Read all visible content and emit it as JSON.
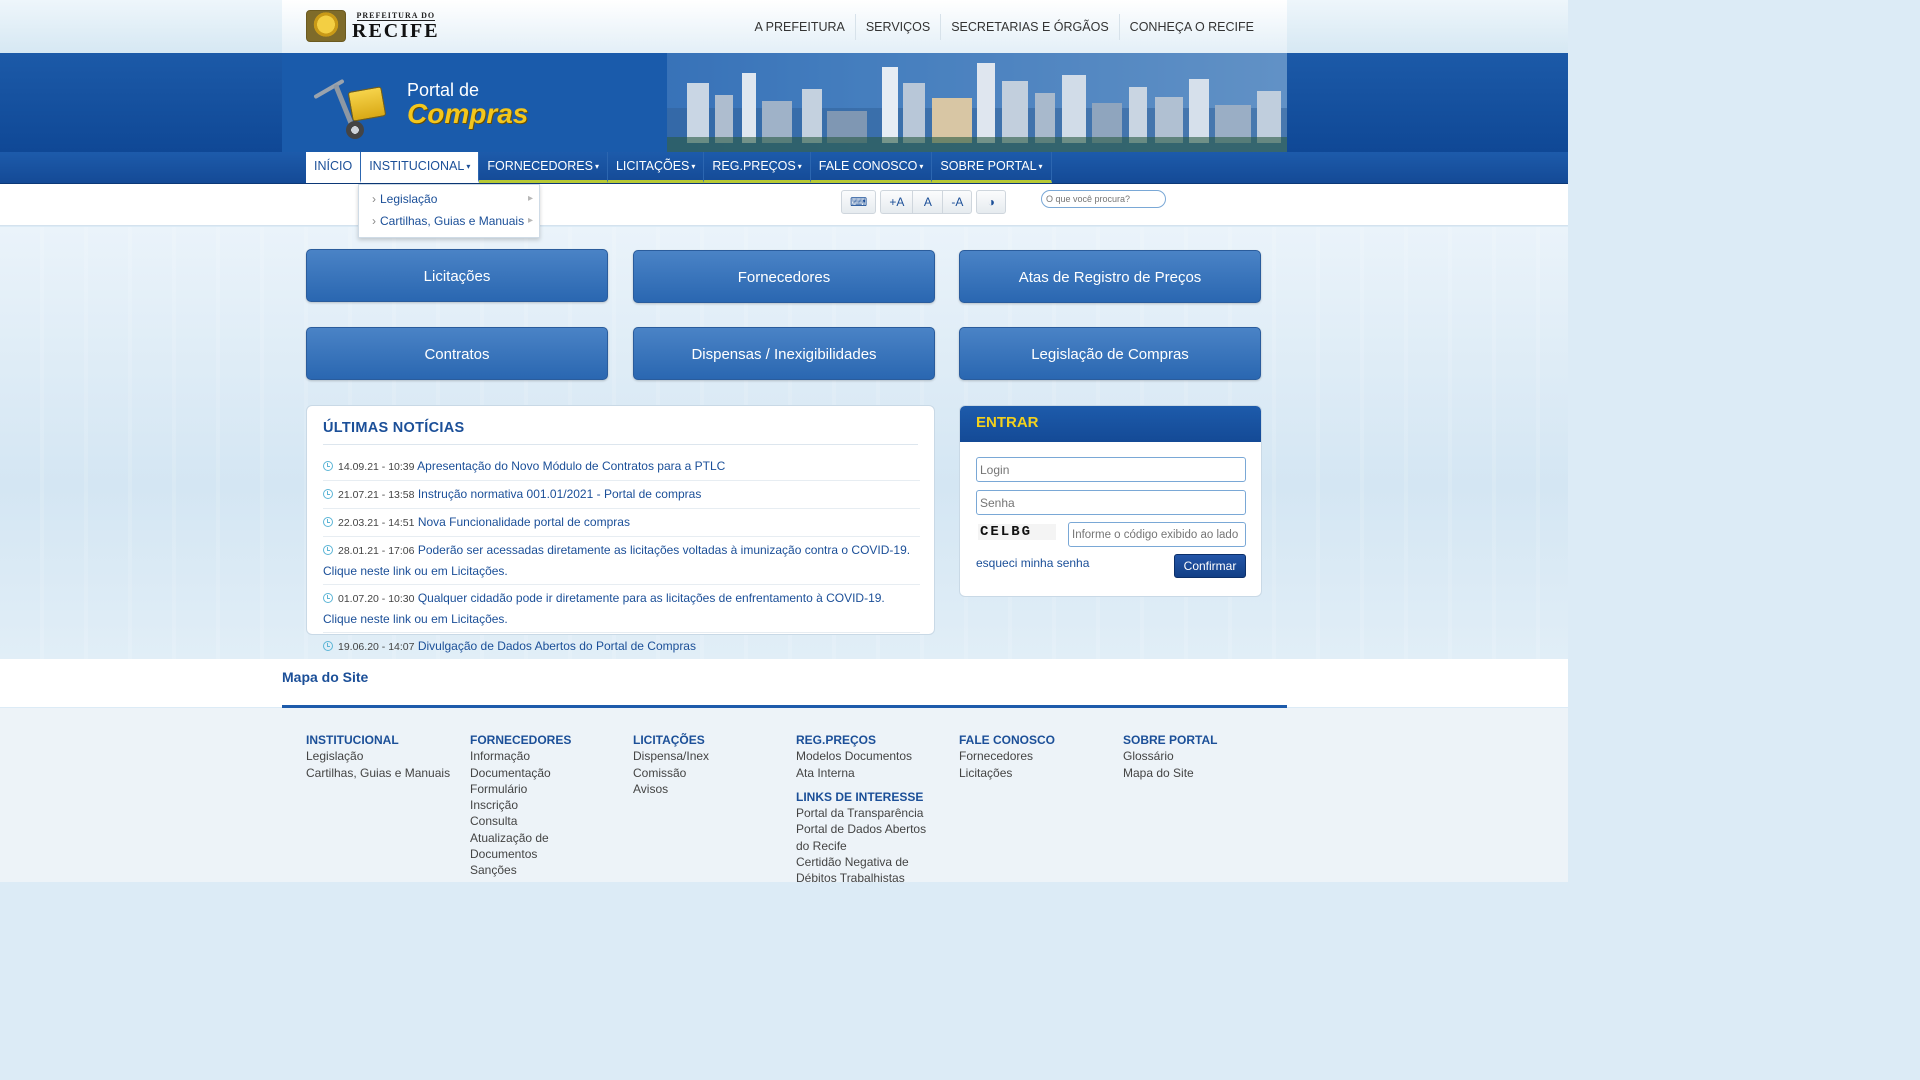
{
  "brand": {
    "top": "PREFEITURA DO",
    "main": "RECIFE"
  },
  "top_nav": [
    "A PREFEITURA",
    "SERVIÇOS",
    "SECRETARIAS E ÓRGÃOS",
    "CONHEÇA O RECIFE"
  ],
  "banner": {
    "line1": "Portal de",
    "line2": "Compras"
  },
  "menu": [
    {
      "label": "INÍCIO",
      "caret": ""
    },
    {
      "label": "INSTITUCIONAL",
      "caret": "▾"
    },
    {
      "label": "FORNECEDORES",
      "caret": "▾"
    },
    {
      "label": "LICITAÇÕES",
      "caret": "▾"
    },
    {
      "label": "REG.PREÇOS",
      "caret": "▾"
    },
    {
      "label": "FALE CONOSCO",
      "caret": "▾"
    },
    {
      "label": "SOBRE PORTAL",
      "caret": "▾"
    }
  ],
  "dropdown": [
    "Legislação",
    "Cartilhas, Guias e Manuais"
  ],
  "a11y": {
    "keyboard": "⌨",
    "increase": "+A",
    "normal": "A",
    "decrease": "-A",
    "contrast": "◑"
  },
  "search": {
    "placeholder": "O que você procura?"
  },
  "quick_links": [
    "Licitações",
    "Fornecedores",
    "Atas de Registro de Preços",
    "Contratos",
    "Dispensas / Inexigibilidades",
    "Legislação de Compras"
  ],
  "news": {
    "title": "ÚLTIMAS NOTÍCIAS",
    "items": [
      {
        "date": "14.09.21 - 10:39",
        "text": "Apresentação do Novo Módulo de Contratos para a PTLC"
      },
      {
        "date": "21.07.21 - 13:58",
        "text": "Instrução normativa 001.01/2021 - Portal de compras"
      },
      {
        "date": "22.03.21 - 14:51",
        "text": "Nova Funcionalidade portal de compras"
      },
      {
        "date": "28.01.21 - 17:06",
        "text": "Poderão ser acessadas diretamente as licitações voltadas à imunização contra o COVID-19. Clique neste link ou em Licitações."
      },
      {
        "date": "01.07.20 - 10:30",
        "text": "Qualquer cidadão pode ir diretamente para as licitações de enfrentamento à COVID-19. Clique neste link ou em Licitações."
      },
      {
        "date": "19.06.20 - 14:07",
        "text": "Divulgação de Dados Abertos do Portal de Compras"
      }
    ]
  },
  "login": {
    "title": "ENTRAR",
    "login_placeholder": "Login",
    "password_placeholder": "Senha",
    "captcha": "CELBG",
    "captcha_placeholder": "Informe o código exibido ao lado",
    "forgot": "esqueci minha senha",
    "confirm": "Confirmar"
  },
  "site_map": {
    "title": "Mapa do Site",
    "columns": [
      {
        "head": "INSTITUCIONAL",
        "links": [
          "Legislação",
          "Cartilhas, Guias e Manuais"
        ]
      },
      {
        "head": "FORNECEDORES",
        "links": [
          "Informação",
          "Documentação",
          "Formulário",
          "Inscrição",
          "Consulta",
          "Atualização de",
          "Documentos",
          "Sanções"
        ]
      },
      {
        "head": "LICITAÇÕES",
        "links": [
          "Dispensa/Inex",
          "Comissão",
          "Avisos"
        ]
      },
      {
        "head": "REG.PREÇOS",
        "links": [
          "Modelos Documentos",
          "Ata Interna"
        ]
      },
      {
        "head": "FALE CONOSCO",
        "links": [
          "Fornecedores",
          "Licitações"
        ]
      },
      {
        "head": "SOBRE PORTAL",
        "links": [
          "Glossário",
          "Mapa do Site"
        ]
      }
    ],
    "interest": {
      "head": "LINKS DE INTERESSE",
      "links": [
        "Portal da Transparência",
        "Portal de Dados Abertos",
        "do Recife",
        "Certidão Negativa de",
        "Débitos Trabalhistas"
      ]
    }
  }
}
